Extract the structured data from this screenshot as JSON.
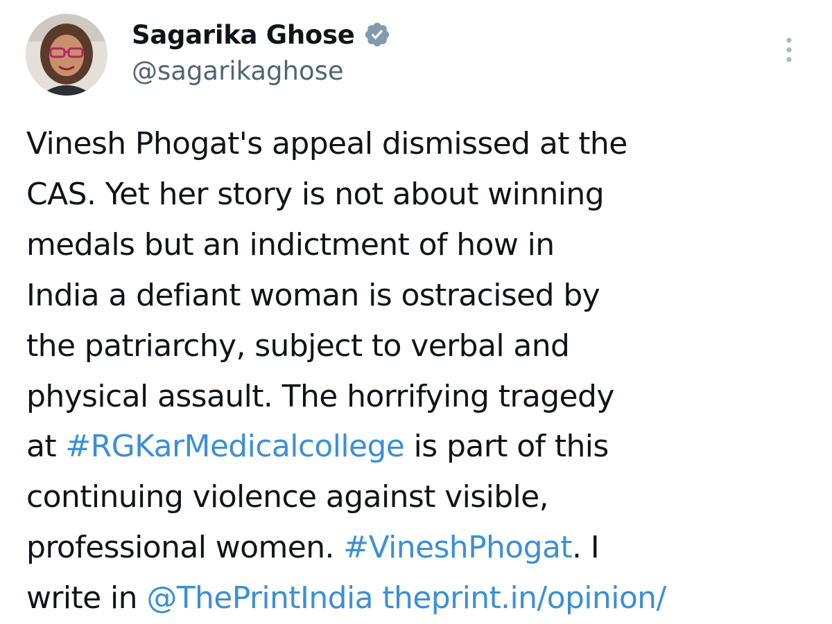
{
  "author": {
    "display_name": "Sagarika Ghose",
    "handle": "@sagarikaghose",
    "verified": true,
    "verified_icon": "verified-badge-icon",
    "avatar": "profile-photo"
  },
  "menu": {
    "icon": "more-options-icon"
  },
  "tweet": {
    "lines": [
      [
        {
          "t": "Vinesh Phogat's appeal dismissed at the"
        }
      ],
      [
        {
          "t": "CAS. Yet her story is not about winning"
        }
      ],
      [
        {
          "t": "medals but an indictment of how in"
        }
      ],
      [
        {
          "t": "India a defiant woman is ostracised by"
        }
      ],
      [
        {
          "t": "the patriarchy, subject to verbal and"
        }
      ],
      [
        {
          "t": "physical assault. The horrifying tragedy"
        }
      ],
      [
        {
          "t": "at "
        },
        {
          "t": "#RGKarMedicalcollege",
          "link": "hashtag"
        },
        {
          "t": " is part of this"
        }
      ],
      [
        {
          "t": "continuing violence against visible,"
        }
      ],
      [
        {
          "t": "professional women. "
        },
        {
          "t": "#VineshPhogat",
          "link": "hashtag"
        },
        {
          "t": ". I"
        }
      ],
      [
        {
          "t": "write in "
        },
        {
          "t": "@ThePrintIndia",
          "link": "mention"
        },
        {
          "t": " "
        },
        {
          "t": "theprint.in/opinion/",
          "link": "url"
        }
      ]
    ]
  },
  "colors": {
    "text": "#0f1419",
    "secondary": "#536471",
    "link": "#3b8fd6",
    "badge": "#829aab"
  }
}
